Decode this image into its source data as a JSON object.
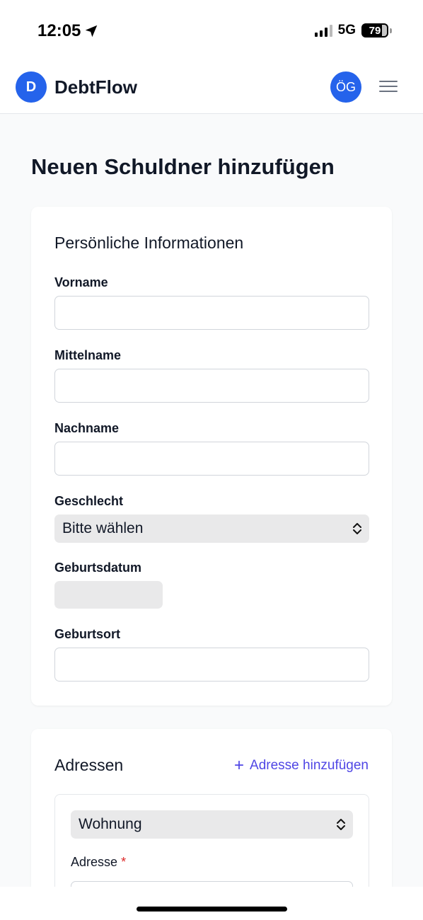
{
  "status": {
    "time": "12:05",
    "network": "5G",
    "battery": "79"
  },
  "header": {
    "logo_letter": "D",
    "app_name": "DebtFlow",
    "avatar_initials": "ÖG"
  },
  "page": {
    "title": "Neuen Schuldner hinzufügen"
  },
  "personal": {
    "section_title": "Persönliche Informationen",
    "first_name_label": "Vorname",
    "first_name_value": "",
    "middle_name_label": "Mittelname",
    "middle_name_value": "",
    "last_name_label": "Nachname",
    "last_name_value": "",
    "gender_label": "Geschlecht",
    "gender_value": "Bitte wählen",
    "birthdate_label": "Geburtsdatum",
    "birthplace_label": "Geburtsort",
    "birthplace_value": ""
  },
  "addresses": {
    "section_title": "Adressen",
    "add_label": "Adresse hinzufügen",
    "type_value": "Wohnung",
    "address_label": "Adresse",
    "required_mark": "*"
  },
  "colors": {
    "primary": "#2563eb",
    "link": "#4f46e5",
    "required": "#dc2626"
  }
}
